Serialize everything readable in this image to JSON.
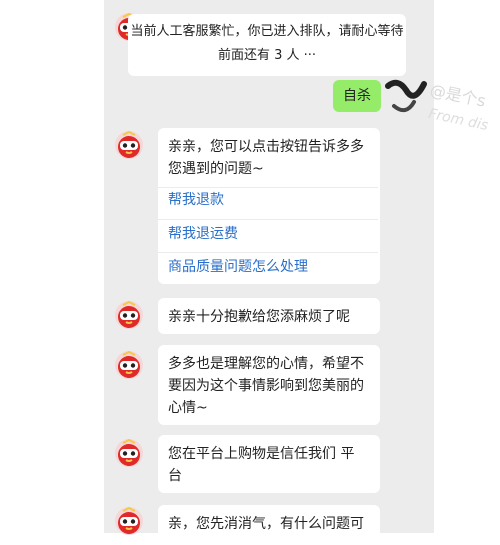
{
  "queue_notice": {
    "line1": "当前人工客服繁忙，你已进入排队，请耐心等待",
    "line2": "前面还有 3 人 ···"
  },
  "user_message": "自杀",
  "watermark": {
    "line1": "@是个s",
    "line2": "From dis"
  },
  "messages": [
    {
      "lines": [
        "亲亲，您可以点击按钮告诉多多",
        "您遇到的问题~"
      ],
      "links": [
        "帮我退款",
        "帮我退运费",
        "商品质量问题怎么处理"
      ]
    },
    {
      "lines": [
        "亲亲十分抱歉给您添麻烦了呢"
      ]
    },
    {
      "lines": [
        "多多也是理解您的心情，希望不",
        "要因为这个事情影响到您美丽的",
        "心情~"
      ]
    },
    {
      "lines": [
        "您在平台上购物是信任我们 平",
        "台"
      ]
    },
    {
      "lines": [
        "亲，您先消消气，有什么问题可"
      ]
    }
  ],
  "colors": {
    "chat_bg": "#ececec",
    "user_bubble": "#95ec69",
    "link": "#2a6fc9",
    "avatar_red": "#e02a2a"
  },
  "icons": {
    "agent_avatar": "pinduoduo-mascot-icon",
    "user_avatar": "user-profile-icon"
  }
}
